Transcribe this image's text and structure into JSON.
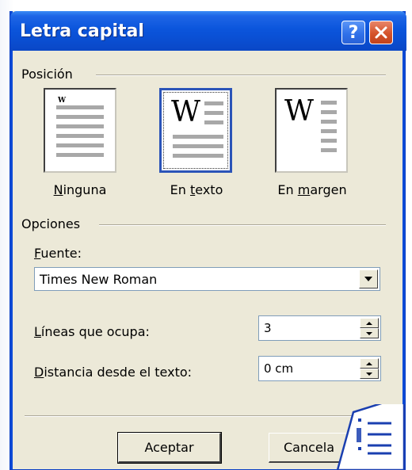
{
  "dialog": {
    "title": "Letra capital",
    "help_glyph": "?",
    "close_icon": "close-icon"
  },
  "position_group": {
    "label": "Posición",
    "options": [
      {
        "pre": "",
        "key": "N",
        "post": "inguna",
        "full": "Ninguna",
        "selected": false
      },
      {
        "pre": "En ",
        "key": "t",
        "post": "exto",
        "full": "En texto",
        "selected": true
      },
      {
        "pre": "En ",
        "key": "m",
        "post": "argen",
        "full": "En margen",
        "selected": false
      }
    ],
    "drop_letter": "W",
    "small_letter": "W"
  },
  "options_group": {
    "label": "Opciones",
    "font_label_key": "F",
    "font_label_rest": "uente:",
    "font_value": "Times New Roman",
    "lines_label_key": "L",
    "lines_label_rest": "íneas que ocupa:",
    "lines_value": "3",
    "distance_label_key": "D",
    "distance_label_rest": "istancia desde el texto:",
    "distance_value": "0 cm"
  },
  "buttons": {
    "ok": "Aceptar",
    "cancel": "Cancela"
  },
  "colors": {
    "titlebar": "#0a4fd3",
    "dialog_bg": "#ece9d8",
    "badge_blue": "#1a3fb0"
  }
}
